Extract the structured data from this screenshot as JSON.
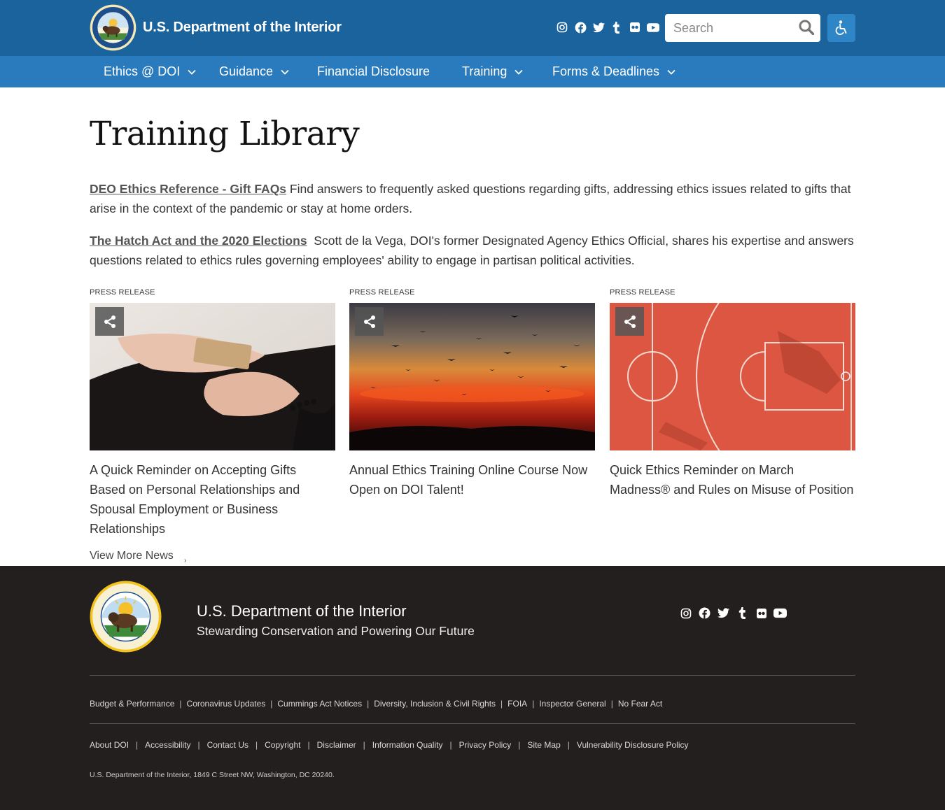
{
  "header": {
    "site_title": "U.S. Department of the Interior",
    "search_placeholder": "Search",
    "social": [
      "instagram-icon",
      "facebook-icon",
      "twitter-icon",
      "tumblr-icon",
      "flickr-icon",
      "youtube-icon"
    ],
    "accessibility_icon": "wheelchair-icon"
  },
  "nav": {
    "items": [
      {
        "label": "Ethics @ DOI",
        "has_menu": true
      },
      {
        "label": "Guidance",
        "has_menu": true
      },
      {
        "label": "Financial Disclosure",
        "has_menu": false
      },
      {
        "label": "Training",
        "has_menu": true
      },
      {
        "label": "Forms & Deadlines",
        "has_menu": true
      }
    ]
  },
  "main": {
    "title": "Training Library",
    "references": [
      {
        "link": "DEO Ethics Reference - Gift FAQs",
        "text": "Find answers to frequently asked questions regarding gifts, addressing ethics issues related to gifts that arise in the context of the pandemic or stay at home orders."
      },
      {
        "link": "The Hatch Act and the 2020 Elections",
        "text": "Scott de la Vega, DOI's former Designated Agency Ethics Official, shares his expertise and answers questions related to ethics rules governing employees' ability to engage in partisan political activities."
      }
    ],
    "cards": [
      {
        "tag": "PRESS RELEASE",
        "title": "A Quick Reminder on Accepting Gifts Based on Personal Relationships and Spousal Employment or Business Relationships"
      },
      {
        "tag": "PRESS RELEASE",
        "title": "Annual Ethics Training Online Course Now Open on DOI Talent!"
      },
      {
        "tag": "PRESS RELEASE",
        "title": "Quick Ethics Reminder on March Madness® and Rules on Misuse of Position"
      }
    ],
    "view_more": "View More News",
    "view_more_arrow": "›"
  },
  "footer": {
    "title": "U.S. Department of the Interior",
    "tagline": "Stewarding Conservation and Powering Our Future",
    "links_row1": [
      "Budget & Performance",
      "Coronavirus Updates",
      "Cummings Act Notices",
      "Diversity, Inclusion & Civil Rights",
      "FOIA",
      "Inspector General",
      "No Fear Act"
    ],
    "links_row2": [
      "About DOI",
      "Accessibility",
      "Contact Us",
      "Copyright",
      "Disclaimer",
      "Information Quality",
      "Privacy Policy",
      "Site Map",
      "Vulnerability Disclosure Policy"
    ],
    "address": "U.S. Department of the Interior, 1849 C Street NW, Washington, DC 20240.",
    "separator": "|"
  },
  "colors": {
    "header_bg": "#1b639c",
    "nav_bg": "#2a7bbd",
    "accessibility_bg": "#2e86c6",
    "footer_bg": "#231f1e"
  }
}
